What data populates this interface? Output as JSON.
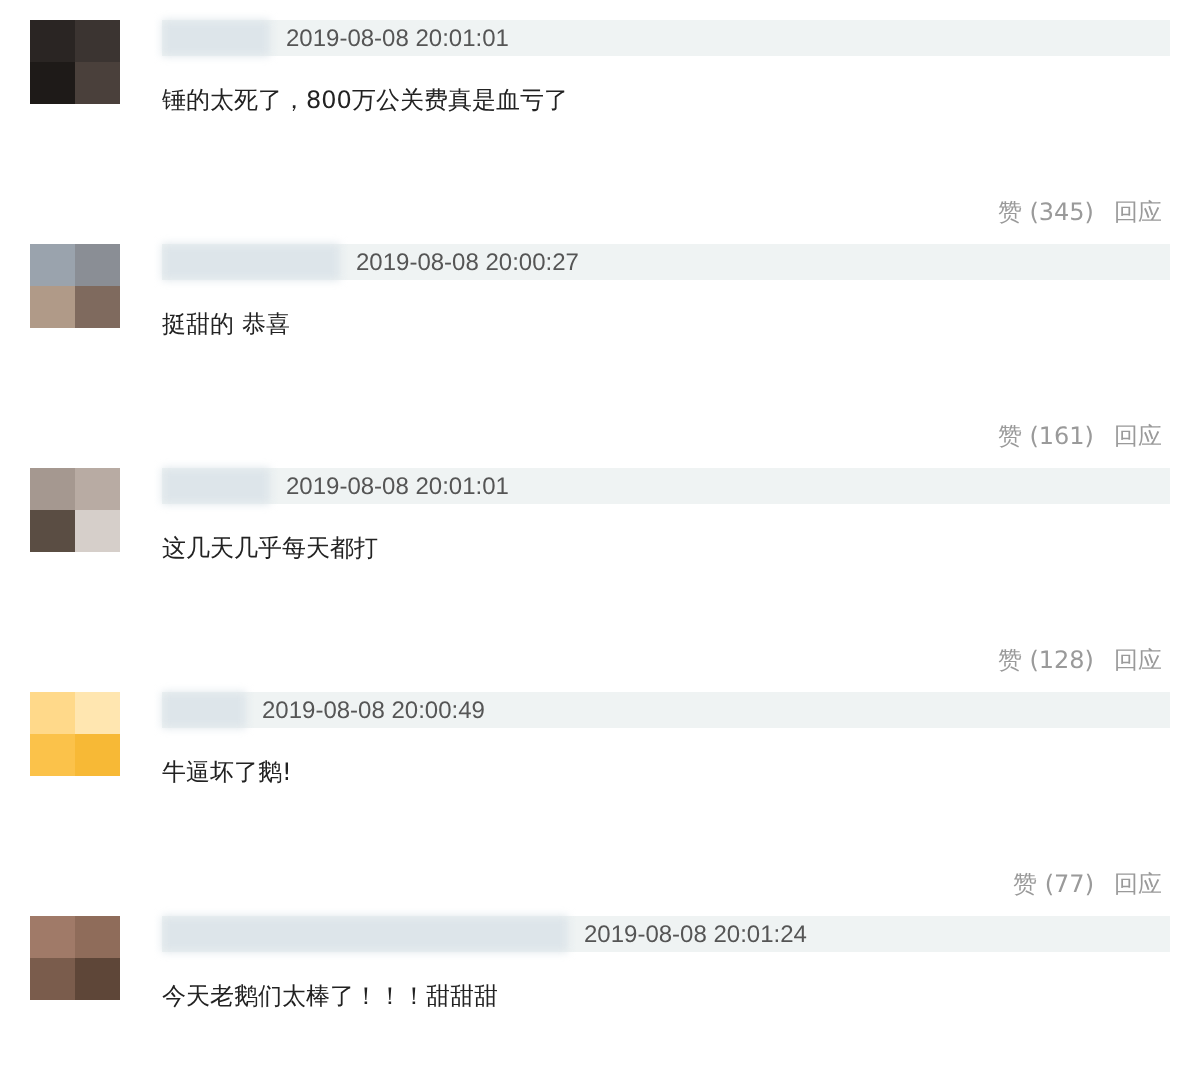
{
  "comments": [
    {
      "time": "2019-08-08 20:01:01",
      "text": "锤的太死了，800万公关费真是血亏了"
    },
    {
      "likes": "赞 (345)",
      "reply": "回应",
      "time": "2019-08-08 20:00:27",
      "text": "挺甜的 恭喜"
    },
    {
      "likes": "赞 (161)",
      "reply": "回应",
      "time": "2019-08-08 20:01:01",
      "text": "这几天几乎每天都打"
    },
    {
      "likes": "赞 (128)",
      "reply": "回应",
      "time": "2019-08-08 20:00:49",
      "text": "牛逼坏了鹅!"
    },
    {
      "likes": "赞 (77)",
      "reply": "回应",
      "time": "2019-08-08 20:01:24",
      "text": "今天老鹅们太棒了！！！甜甜甜"
    }
  ]
}
